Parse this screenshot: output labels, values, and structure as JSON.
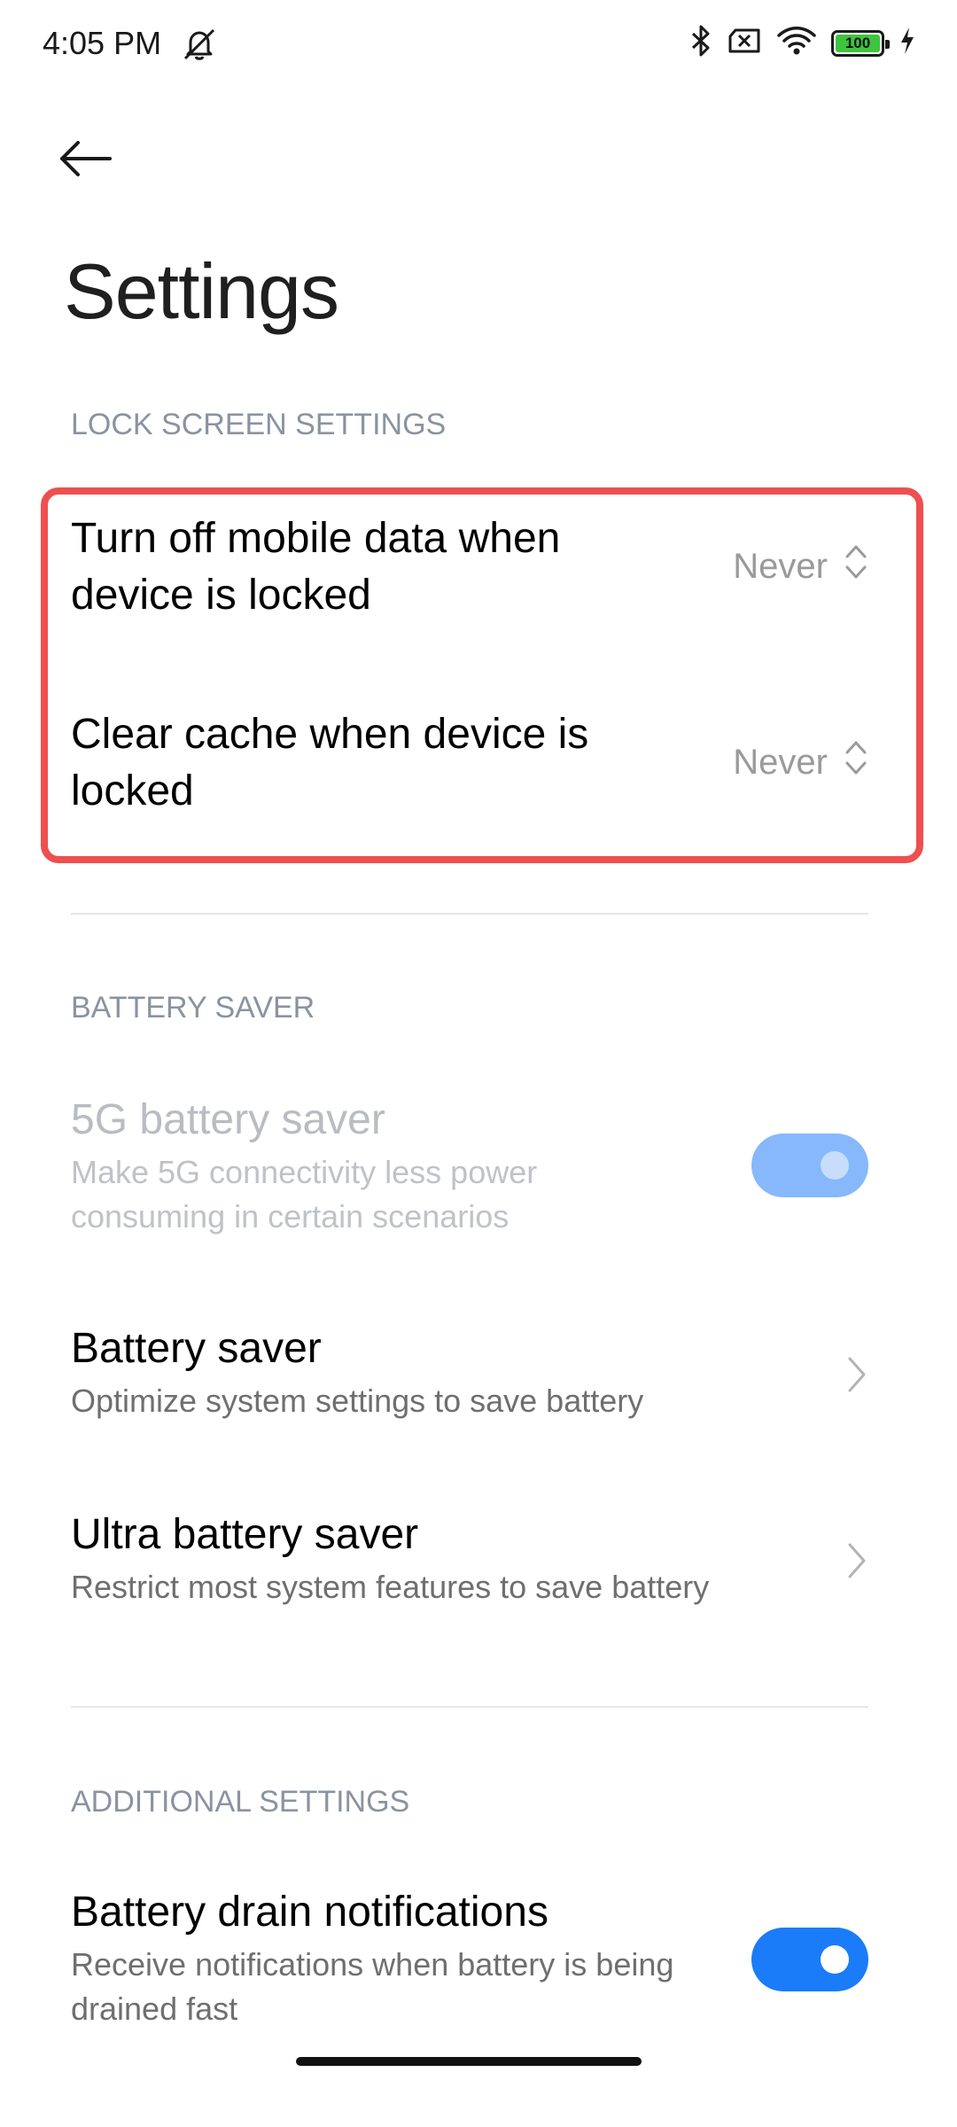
{
  "status_bar": {
    "time": "4:05 PM",
    "battery_level": "100",
    "icons": [
      "silent-icon",
      "bluetooth-icon",
      "no-sim-icon",
      "wifi-icon",
      "battery-icon",
      "charging-icon"
    ]
  },
  "header": {
    "title": "Settings"
  },
  "lock_screen": {
    "section_title": "LOCK SCREEN SETTINGS",
    "items": [
      {
        "title": "Turn off mobile data when device is locked",
        "value": "Never"
      },
      {
        "title": "Clear cache when device is locked",
        "value": "Never"
      }
    ]
  },
  "battery_saver": {
    "section_title": "BATTERY SAVER",
    "items": [
      {
        "title": "5G battery saver",
        "subtitle": "Make 5G connectivity less power consuming in certain scenarios",
        "toggle": true,
        "enabled": false
      },
      {
        "title": "Battery saver",
        "subtitle": "Optimize system settings to save battery"
      },
      {
        "title": "Ultra battery saver",
        "subtitle": "Restrict most system features to save battery"
      }
    ]
  },
  "additional": {
    "section_title": "ADDITIONAL SETTINGS",
    "items": [
      {
        "title": "Battery drain notifications",
        "subtitle": "Receive notifications when battery is being drained fast",
        "toggle": true
      }
    ]
  },
  "colors": {
    "highlight": "#ee4f50",
    "toggle_on": "#1a7cf8",
    "toggle_disabled": "#86b8fb",
    "section_header": "#8a93a0"
  }
}
